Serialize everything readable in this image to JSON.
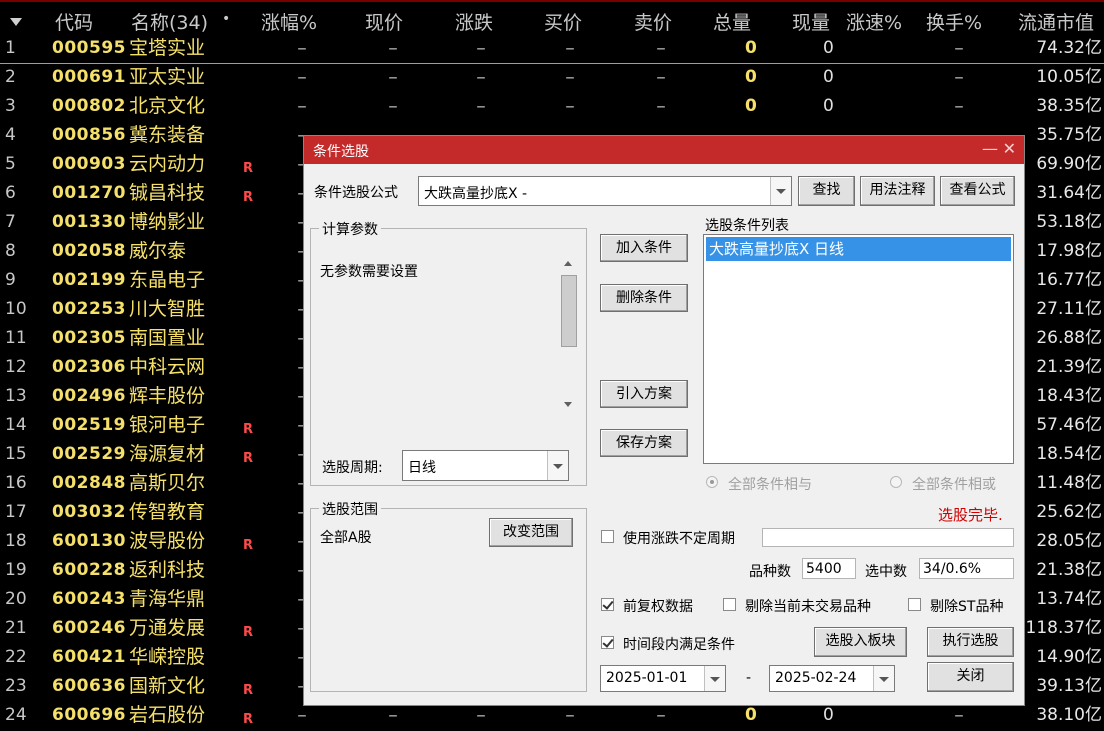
{
  "columns": {
    "code": "代码",
    "name": "名称(34)",
    "name_dot": "•",
    "change_pct": "涨幅%",
    "price": "现价",
    "change": "涨跌",
    "bid": "买价",
    "ask": "卖价",
    "volume": "总量",
    "cur_volume": "现量",
    "speed": "涨速%",
    "turnover": "换手%",
    "float_cap": "流通市值"
  },
  "dash": "–",
  "rows": [
    {
      "n": "1",
      "code": "000595",
      "name": "宝塔实业",
      "flag": "",
      "vol": "0",
      "cur": "0",
      "cap": "74.32亿",
      "full": true
    },
    {
      "n": "2",
      "code": "000691",
      "name": "亚太实业",
      "flag": "",
      "vol": "0",
      "cur": "0",
      "cap": "10.05亿",
      "full": true
    },
    {
      "n": "3",
      "code": "000802",
      "name": "北京文化",
      "flag": "",
      "vol": "0",
      "cur": "0",
      "cap": "38.35亿",
      "full": true
    },
    {
      "n": "4",
      "code": "000856",
      "name": "冀东装备",
      "flag": "",
      "cap": "35.75亿"
    },
    {
      "n": "5",
      "code": "000903",
      "name": "云内动力",
      "flag": "R",
      "cap": "69.90亿"
    },
    {
      "n": "6",
      "code": "001270",
      "name": "铖昌科技",
      "flag": "R",
      "cap": "31.64亿"
    },
    {
      "n": "7",
      "code": "001330",
      "name": "博纳影业",
      "flag": "",
      "cap": "53.18亿"
    },
    {
      "n": "8",
      "code": "002058",
      "name": "威尔泰",
      "flag": "",
      "cap": "17.98亿"
    },
    {
      "n": "9",
      "code": "002199",
      "name": "东晶电子",
      "flag": "",
      "cap": "16.77亿"
    },
    {
      "n": "10",
      "code": "002253",
      "name": "川大智胜",
      "flag": "",
      "cap": "27.11亿"
    },
    {
      "n": "11",
      "code": "002305",
      "name": "南国置业",
      "flag": "",
      "cap": "26.88亿"
    },
    {
      "n": "12",
      "code": "002306",
      "name": "中科云网",
      "flag": "",
      "cap": "21.39亿"
    },
    {
      "n": "13",
      "code": "002496",
      "name": "辉丰股份",
      "flag": "",
      "cap": "18.43亿"
    },
    {
      "n": "14",
      "code": "002519",
      "name": "银河电子",
      "flag": "R",
      "cap": "57.46亿"
    },
    {
      "n": "15",
      "code": "002529",
      "name": "海源复材",
      "flag": "R",
      "cap": "18.54亿"
    },
    {
      "n": "16",
      "code": "002848",
      "name": "高斯贝尔",
      "flag": "",
      "cap": "11.48亿"
    },
    {
      "n": "17",
      "code": "003032",
      "name": "传智教育",
      "flag": "",
      "cap": "25.62亿"
    },
    {
      "n": "18",
      "code": "600130",
      "name": "波导股份",
      "flag": "R",
      "cap": "28.05亿"
    },
    {
      "n": "19",
      "code": "600228",
      "name": "返利科技",
      "flag": "",
      "cap": "21.38亿"
    },
    {
      "n": "20",
      "code": "600243",
      "name": "青海华鼎",
      "flag": "",
      "cap": "13.74亿"
    },
    {
      "n": "21",
      "code": "600246",
      "name": "万通发展",
      "flag": "R",
      "cap": "118.37亿"
    },
    {
      "n": "22",
      "code": "600421",
      "name": "华嵘控股",
      "flag": "",
      "cap": "14.90亿"
    },
    {
      "n": "23",
      "code": "600636",
      "name": "国新文化",
      "flag": "R",
      "cap": "39.13亿"
    },
    {
      "n": "24",
      "code": "600696",
      "name": "岩石股份",
      "flag": "R",
      "vol": "0",
      "cur": "0",
      "cap": "38.10亿",
      "full": true
    }
  ],
  "dialog": {
    "title": "条件选股",
    "minimize": "—",
    "close": "✕",
    "formula_label": "条件选股公式",
    "formula_value": "大跌高量抄底X  -",
    "find_btn": "查找",
    "usage_btn": "用法注释",
    "view_btn": "查看公式",
    "params_group": "计算参数",
    "params_text": "无参数需要设置",
    "period_label": "选股周期:",
    "period_value": "日线",
    "add_btn": "加入条件",
    "delete_btn": "删除条件",
    "import_btn": "引入方案",
    "save_btn": "保存方案",
    "conditions_label": "选股条件列表",
    "conditions": [
      "大跌高量抄底X  日线"
    ],
    "radio_and": "全部条件相与",
    "radio_or": "全部条件相或",
    "status": "选股完毕.",
    "scope_group": "选股范围",
    "scope_value": "全部A股",
    "change_scope_btn": "改变范围",
    "variable_period_label": "使用涨跌不定周期",
    "variable_period_checked": false,
    "count_label": "品种数",
    "count_value": "5400",
    "selected_label": "选中数",
    "selected_value": "34/0.6%",
    "adjusted_label": "前复权数据",
    "adjusted_checked": true,
    "exclude_untraded_label": "剔除当前未交易品种",
    "exclude_untraded_checked": false,
    "exclude_st_label": "剔除ST品种",
    "exclude_st_checked": false,
    "time_range_label": "时间段内满足条件",
    "time_range_checked": true,
    "to_block_btn": "选股入板块",
    "execute_btn": "执行选股",
    "date_from": "2025-01-01",
    "date_sep": "-",
    "date_to": "2025-02-24",
    "close_btn": "关闭"
  },
  "colors": {
    "title_bar": "#c52a2a",
    "selection": "#3592e6",
    "status_text": "#d00000",
    "code_text": "#f4e06a",
    "flag_text": "#ff4a4a"
  }
}
